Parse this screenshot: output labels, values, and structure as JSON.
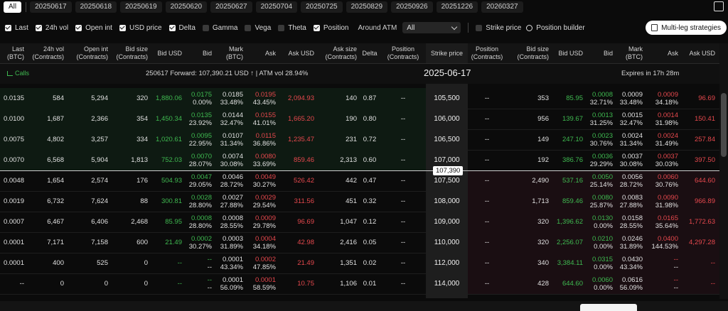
{
  "expiries": {
    "all_label": "All",
    "items": [
      "20250617",
      "20250618",
      "20250619",
      "20250620",
      "20250627",
      "20250704",
      "20250725",
      "20250829",
      "20250926",
      "20251226",
      "20260327"
    ]
  },
  "options": {
    "checks": [
      {
        "label": "Last",
        "on": true
      },
      {
        "label": "24h vol",
        "on": true
      },
      {
        "label": "Open int",
        "on": true
      },
      {
        "label": "USD price",
        "on": true
      },
      {
        "label": "Delta",
        "on": true
      },
      {
        "label": "Gamma",
        "on": false
      },
      {
        "label": "Vega",
        "on": false
      },
      {
        "label": "Theta",
        "on": false
      },
      {
        "label": "Position",
        "on": true
      }
    ],
    "around_atm_label": "Around ATM",
    "around_atm_value": "All",
    "strike_price_label": "Strike price",
    "position_builder_label": "Position builder",
    "multi_leg_label": "Multi-leg strategies"
  },
  "headers": {
    "calls": [
      "Last (BTC)",
      "24h vol (Contracts)",
      "Open int (Contracts)",
      "Bid size (Contracts)",
      "Bid USD",
      "Bid",
      "Mark (BTC)",
      "Ask",
      "Ask USD",
      "Ask size (Contracts)",
      "Delta",
      "Position (Contracts)"
    ],
    "strike": "Strike price",
    "puts": [
      "Position (Contracts)",
      "Bid size (Contracts)",
      "Bid USD",
      "Bid",
      "Mark (BTC)",
      "Ask",
      "Ask USD"
    ]
  },
  "info": {
    "calls_label": "Calls",
    "forward": "250617 Forward: 107,390.21 USD ↑  |  ATM vol 28.94%",
    "date": "2025-06-17",
    "expires": "Expires in 17h 28m",
    "atm_price": "107,390"
  },
  "rows": [
    {
      "strike": "105,500",
      "last": "0.0135",
      "vol": "584",
      "oi": "5,294",
      "bsize": "320",
      "busd": "1,880.06",
      "bid": "0.0175",
      "bid_iv": "0.00%",
      "mark": "0.0185",
      "mark_iv": "33.48%",
      "ask": "0.0195",
      "ask_iv": "43.45%",
      "ausd": "2,094.93",
      "asize": "140",
      "delta": "0.87",
      "pos": "--",
      "p_pos": "--",
      "p_bsize": "353",
      "p_busd": "85.95",
      "p_bid": "0.0008",
      "p_bid_iv": "32.71%",
      "p_mark": "0.0009",
      "p_mark_iv": "33.48%",
      "p_ask": "0.0009",
      "p_ask_iv": "34.18%",
      "p_ausd": "96.69",
      "itm": "call"
    },
    {
      "strike": "106,000",
      "last": "0.0100",
      "vol": "1,687",
      "oi": "2,366",
      "bsize": "354",
      "busd": "1,450.34",
      "bid": "0.0135",
      "bid_iv": "23.92%",
      "mark": "0.0144",
      "mark_iv": "32.47%",
      "ask": "0.0155",
      "ask_iv": "41.01%",
      "ausd": "1,665.20",
      "asize": "190",
      "delta": "0.80",
      "pos": "--",
      "p_pos": "--",
      "p_bsize": "956",
      "p_busd": "139.67",
      "p_bid": "0.0013",
      "p_bid_iv": "31.25%",
      "p_mark": "0.0015",
      "p_mark_iv": "32.47%",
      "p_ask": "0.0014",
      "p_ask_iv": "31.98%",
      "p_ausd": "150.41",
      "itm": "call"
    },
    {
      "strike": "106,500",
      "last": "0.0075",
      "vol": "4,802",
      "oi": "3,257",
      "bsize": "334",
      "busd": "1,020.61",
      "bid": "0.0095",
      "bid_iv": "22.95%",
      "mark": "0.0107",
      "mark_iv": "31.34%",
      "ask": "0.0115",
      "ask_iv": "36.86%",
      "ausd": "1,235.47",
      "asize": "231",
      "delta": "0.72",
      "pos": "--",
      "p_pos": "--",
      "p_bsize": "149",
      "p_busd": "247.10",
      "p_bid": "0.0023",
      "p_bid_iv": "30.76%",
      "p_mark": "0.0024",
      "p_mark_iv": "31.34%",
      "p_ask": "0.0024",
      "p_ask_iv": "31.49%",
      "p_ausd": "257.84",
      "itm": "call"
    },
    {
      "strike": "107,000",
      "last": "0.0070",
      "vol": "6,568",
      "oi": "5,904",
      "bsize": "1,813",
      "busd": "752.03",
      "bid": "0.0070",
      "bid_iv": "28.07%",
      "mark": "0.0074",
      "mark_iv": "30.08%",
      "ask": "0.0080",
      "ask_iv": "33.69%",
      "ausd": "859.46",
      "asize": "2,313",
      "delta": "0.60",
      "pos": "--",
      "p_pos": "--",
      "p_bsize": "192",
      "p_busd": "386.76",
      "p_bid": "0.0036",
      "p_bid_iv": "29.29%",
      "p_mark": "0.0037",
      "p_mark_iv": "30.08%",
      "p_ask": "0.0037",
      "p_ask_iv": "30.03%",
      "p_ausd": "397.50",
      "itm": "call"
    },
    {
      "strike": "107,500",
      "last": "0.0048",
      "vol": "1,654",
      "oi": "2,574",
      "bsize": "176",
      "busd": "504.93",
      "bid": "0.0047",
      "bid_iv": "29.05%",
      "mark": "0.0046",
      "mark_iv": "28.72%",
      "ask": "0.0049",
      "ask_iv": "30.27%",
      "ausd": "526.42",
      "asize": "442",
      "delta": "0.47",
      "pos": "--",
      "p_pos": "--",
      "p_bsize": "2,490",
      "p_busd": "537.16",
      "p_bid": "0.0050",
      "p_bid_iv": "25.14%",
      "p_mark": "0.0056",
      "p_mark_iv": "28.72%",
      "p_ask": "0.0060",
      "p_ask_iv": "30.76%",
      "p_ausd": "644.60",
      "itm": "put"
    },
    {
      "strike": "108,000",
      "last": "0.0019",
      "vol": "6,732",
      "oi": "7,624",
      "bsize": "88",
      "busd": "300.81",
      "bid": "0.0028",
      "bid_iv": "28.80%",
      "mark": "0.0027",
      "mark_iv": "27.88%",
      "ask": "0.0029",
      "ask_iv": "29.54%",
      "ausd": "311.56",
      "asize": "451",
      "delta": "0.32",
      "pos": "--",
      "p_pos": "--",
      "p_bsize": "1,713",
      "p_busd": "859.46",
      "p_bid": "0.0080",
      "p_bid_iv": "25.87%",
      "p_mark": "0.0083",
      "p_mark_iv": "27.88%",
      "p_ask": "0.0090",
      "p_ask_iv": "31.98%",
      "p_ausd": "966.89",
      "itm": "put"
    },
    {
      "strike": "109,000",
      "last": "0.0007",
      "vol": "6,467",
      "oi": "6,406",
      "bsize": "2,468",
      "busd": "85.95",
      "bid": "0.0008",
      "bid_iv": "28.80%",
      "mark": "0.0008",
      "mark_iv": "28.55%",
      "ask": "0.0009",
      "ask_iv": "29.78%",
      "ausd": "96.69",
      "asize": "1,047",
      "delta": "0.12",
      "pos": "--",
      "p_pos": "--",
      "p_bsize": "320",
      "p_busd": "1,396.62",
      "p_bid": "0.0130",
      "p_bid_iv": "0.00%",
      "p_mark": "0.0158",
      "p_mark_iv": "28.55%",
      "p_ask": "0.0165",
      "p_ask_iv": "35.64%",
      "p_ausd": "1,772.63",
      "itm": "put"
    },
    {
      "strike": "110,000",
      "last": "0.0001",
      "vol": "7,171",
      "oi": "7,158",
      "bsize": "600",
      "busd": "21.49",
      "bid": "0.0002",
      "bid_iv": "30.27%",
      "mark": "0.0003",
      "mark_iv": "31.89%",
      "ask": "0.0004",
      "ask_iv": "34.18%",
      "ausd": "42.98",
      "asize": "2,416",
      "delta": "0.05",
      "pos": "--",
      "p_pos": "--",
      "p_bsize": "320",
      "p_busd": "2,256.07",
      "p_bid": "0.0210",
      "p_bid_iv": "0.00%",
      "p_mark": "0.0246",
      "p_mark_iv": "31.89%",
      "p_ask": "0.0400",
      "p_ask_iv": "144.53%",
      "p_ausd": "4,297.28",
      "itm": "put"
    },
    {
      "strike": "112,000",
      "last": "0.0001",
      "vol": "400",
      "oi": "525",
      "bsize": "0",
      "busd": "--",
      "bid": "--",
      "bid_iv": "--",
      "mark": "0.0001",
      "mark_iv": "43.34%",
      "ask": "0.0002",
      "ask_iv": "47.85%",
      "ausd": "21.49",
      "asize": "1,351",
      "delta": "0.02",
      "pos": "--",
      "p_pos": "--",
      "p_bsize": "340",
      "p_busd": "3,384.11",
      "p_bid": "0.0315",
      "p_bid_iv": "0.00%",
      "p_mark": "0.0430",
      "p_mark_iv": "43.34%",
      "p_ask": "--",
      "p_ask_iv": "--",
      "p_ausd": "--",
      "itm": "put"
    },
    {
      "strike": "114,000",
      "last": "--",
      "vol": "0",
      "oi": "0",
      "bsize": "0",
      "busd": "--",
      "bid": "--",
      "bid_iv": "--",
      "mark": "0.0001",
      "mark_iv": "56.09%",
      "ask": "0.0001",
      "ask_iv": "58.59%",
      "ausd": "10.75",
      "asize": "1,106",
      "delta": "0.01",
      "pos": "--",
      "p_pos": "--",
      "p_bsize": "428",
      "p_busd": "644.60",
      "p_bid": "0.0060",
      "p_bid_iv": "0.00%",
      "p_mark": "0.0616",
      "p_mark_iv": "56.09%",
      "p_ask": "--",
      "p_ask_iv": "--",
      "p_ausd": "--",
      "itm": "put"
    }
  ],
  "colors": {
    "green": "#3fb950",
    "red": "#e5484d",
    "bg": "#0b0b0b"
  }
}
